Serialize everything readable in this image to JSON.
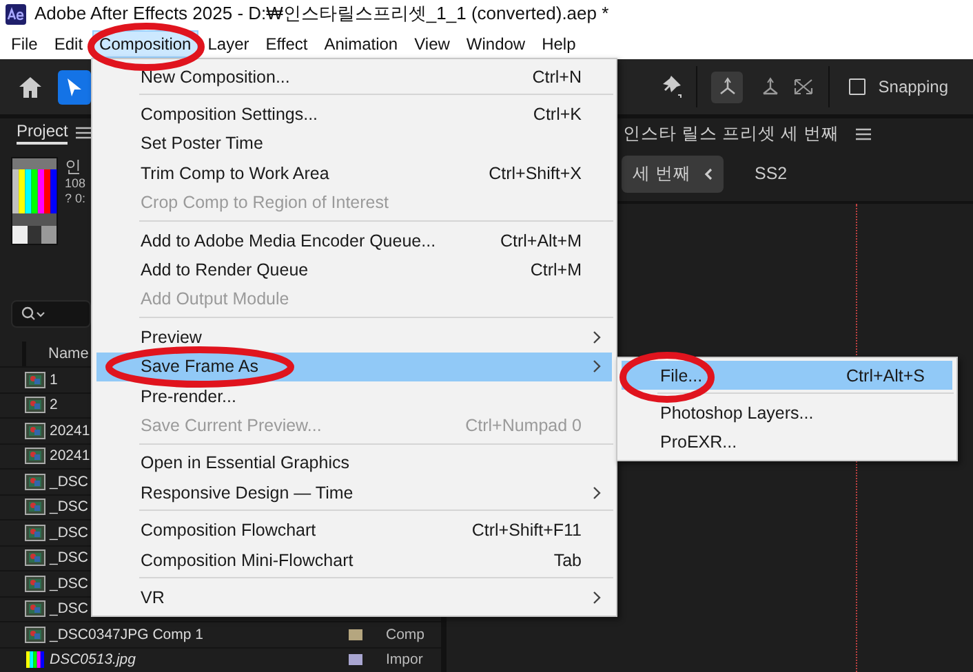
{
  "window": {
    "title": "Adobe After Effects 2025 - D:₩인스타릴스프리셋_1_1 (converted).aep *"
  },
  "menubar": [
    {
      "label": "File",
      "selected": false
    },
    {
      "label": "Edit",
      "selected": false
    },
    {
      "label": "Composition",
      "selected": true
    },
    {
      "label": "Layer",
      "selected": false
    },
    {
      "label": "Effect",
      "selected": false
    },
    {
      "label": "Animation",
      "selected": false
    },
    {
      "label": "View",
      "selected": false
    },
    {
      "label": "Window",
      "selected": false
    },
    {
      "label": "Help",
      "selected": false
    }
  ],
  "toolbar": {
    "snapping": {
      "label": "Snapping",
      "checked": false
    }
  },
  "project": {
    "title": "Project",
    "comp_info": [
      "인",
      "108",
      "? 0:"
    ],
    "column": "Name",
    "items": [
      {
        "name": "1",
        "kind": "comp"
      },
      {
        "name": "2",
        "kind": "comp"
      },
      {
        "name": "20241",
        "kind": "comp"
      },
      {
        "name": "20241",
        "kind": "comp"
      },
      {
        "name": "_DSC",
        "kind": "comp"
      },
      {
        "name": "_DSC",
        "kind": "comp"
      },
      {
        "name": "_DSC",
        "kind": "comp"
      },
      {
        "name": "_DSC",
        "kind": "comp"
      },
      {
        "name": "_DSC",
        "kind": "comp"
      },
      {
        "name": "_DSC",
        "kind": "comp"
      },
      {
        "name": "_DSC0347JPG Comp 1",
        "kind": "comp",
        "type": "Comp",
        "color": "#b5a67f"
      },
      {
        "name": "DSC0513.jpg",
        "kind": "footage",
        "type": "Impor",
        "color": "#a9a6d1"
      }
    ]
  },
  "viewer": {
    "title": "인스타 릴스 프리셋 세 번째",
    "tabs": [
      {
        "label": "세 번째",
        "selected": true
      },
      {
        "label": "SS2",
        "selected": false
      }
    ]
  },
  "composition_menu": [
    {
      "kind": "item",
      "label": "New Composition...",
      "shortcut": "Ctrl+N",
      "disabled": false,
      "selected": false
    },
    {
      "kind": "separator"
    },
    {
      "kind": "item",
      "label": "Composition Settings...",
      "shortcut": "Ctrl+K",
      "disabled": false,
      "selected": false
    },
    {
      "kind": "item",
      "label": "Set Poster Time",
      "disabled": false,
      "selected": false
    },
    {
      "kind": "item",
      "label": "Trim Comp to Work Area",
      "shortcut": "Ctrl+Shift+X",
      "disabled": false,
      "selected": false
    },
    {
      "kind": "item",
      "label": "Crop Comp to Region of Interest",
      "disabled": true,
      "selected": false
    },
    {
      "kind": "separator"
    },
    {
      "kind": "item",
      "label": "Add to Adobe Media Encoder Queue...",
      "shortcut": "Ctrl+Alt+M",
      "disabled": false,
      "selected": false
    },
    {
      "kind": "item",
      "label": "Add to Render Queue",
      "shortcut": "Ctrl+M",
      "disabled": false,
      "selected": false
    },
    {
      "kind": "item",
      "label": "Add Output Module",
      "disabled": true,
      "selected": false
    },
    {
      "kind": "separator"
    },
    {
      "kind": "item",
      "label": "Preview",
      "submenu": true,
      "disabled": false,
      "selected": false
    },
    {
      "kind": "item",
      "label": "Save Frame As",
      "submenu": true,
      "disabled": false,
      "selected": true
    },
    {
      "kind": "item",
      "label": "Pre-render...",
      "disabled": false,
      "selected": false
    },
    {
      "kind": "item",
      "label": "Save Current Preview...",
      "shortcut": "Ctrl+Numpad 0",
      "disabled": true,
      "selected": false
    },
    {
      "kind": "separator"
    },
    {
      "kind": "item",
      "label": "Open in Essential Graphics",
      "disabled": false,
      "selected": false
    },
    {
      "kind": "item",
      "label": "Responsive Design — Time",
      "submenu": true,
      "disabled": false,
      "selected": false
    },
    {
      "kind": "separator"
    },
    {
      "kind": "item",
      "label": "Composition Flowchart",
      "shortcut": "Ctrl+Shift+F11",
      "disabled": false,
      "selected": false
    },
    {
      "kind": "item",
      "label": "Composition Mini-Flowchart",
      "shortcut": "Tab",
      "disabled": false,
      "selected": false
    },
    {
      "kind": "separator"
    },
    {
      "kind": "item",
      "label": "VR",
      "submenu": true,
      "disabled": false,
      "selected": false
    }
  ],
  "save_frame_submenu": [
    {
      "kind": "item",
      "label": "File...",
      "shortcut": "Ctrl+Alt+S",
      "disabled": false,
      "selected": true
    },
    {
      "kind": "separator"
    },
    {
      "kind": "item",
      "label": "Photoshop Layers...",
      "disabled": false,
      "selected": false
    },
    {
      "kind": "item",
      "label": "ProEXR...",
      "disabled": false,
      "selected": false
    }
  ]
}
